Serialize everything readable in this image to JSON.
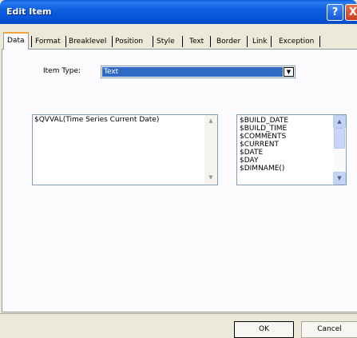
{
  "window": {
    "title": "Edit Item"
  },
  "title_buttons": {
    "help": "?",
    "close": "X"
  },
  "tabs": [
    {
      "label": "Data",
      "active": true
    },
    {
      "label": "Format",
      "active": false
    },
    {
      "label": "Breaklevel",
      "active": false
    },
    {
      "label": "Position",
      "active": false
    },
    {
      "label": "Style",
      "active": false
    },
    {
      "label": "Text",
      "active": false
    },
    {
      "label": "Border",
      "active": false
    },
    {
      "label": "Link",
      "active": false
    },
    {
      "label": "Exception",
      "active": false
    }
  ],
  "item_type": {
    "label": "Item Type:",
    "value": "Text"
  },
  "expression": {
    "value": "$QVVAL(Time Series Current Date)"
  },
  "variables": [
    "$BUILD_DATE",
    "$BUILD_TIME",
    "$COMMENTS",
    "$CURRENT",
    "$DATE",
    "$DAY",
    "$DIMNAME()"
  ],
  "buttons": {
    "ok": "OK",
    "cancel": "Cancel"
  }
}
